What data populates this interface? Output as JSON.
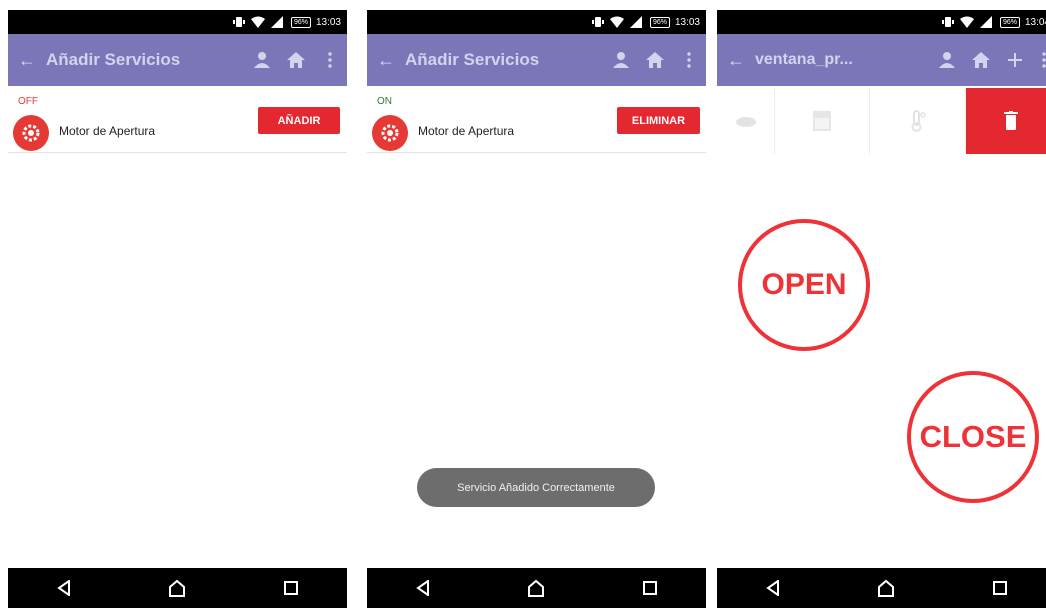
{
  "screens": [
    {
      "status_bar": {
        "battery": "96%",
        "time": "13:03"
      },
      "app_bar": {
        "title": "Añadir Servicios"
      },
      "service": {
        "state": "OFF",
        "name": "Motor de Apertura",
        "action": "AÑADIR"
      }
    },
    {
      "status_bar": {
        "battery": "96%",
        "time": "13:03"
      },
      "app_bar": {
        "title": "Añadir Servicios"
      },
      "service": {
        "state": "ON",
        "name": "Motor de Apertura",
        "action": "ELIMINAR"
      },
      "toast": "Servicio Añadido Correctamente"
    },
    {
      "status_bar": {
        "battery": "96%",
        "time": "13:04"
      },
      "app_bar": {
        "title": "ventana_pr..."
      },
      "controls": {
        "open": "OPEN",
        "close": "CLOSE"
      }
    }
  ],
  "colors": {
    "app_bar": "#7b76b8",
    "accent_red": "#e32830",
    "state_off": "#e53935",
    "state_on": "#2e7d32"
  },
  "icons": [
    "back-arrow-icon",
    "person-icon",
    "home-icon",
    "more-vert-icon",
    "plus-icon",
    "cloud-icon",
    "window-icon",
    "thermometer-icon",
    "trash-icon",
    "motor-icon",
    "wifi-icon",
    "signal-icon",
    "vibrate-icon"
  ]
}
